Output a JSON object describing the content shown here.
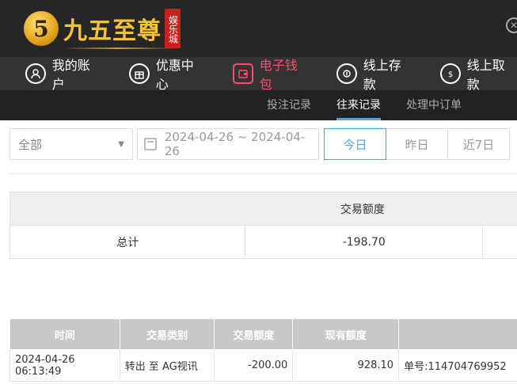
{
  "brand": {
    "badge": "5",
    "name": "九五至尊",
    "seal": "娱乐城"
  },
  "nav": {
    "items": [
      {
        "label": "我的账户",
        "icon": "user-icon"
      },
      {
        "label": "优惠中心",
        "icon": "gift-icon"
      },
      {
        "label": "电子钱包",
        "icon": "wallet-icon",
        "active": true
      },
      {
        "label": "线上存款",
        "icon": "deposit-icon"
      },
      {
        "label": "线上取款",
        "icon": "withdraw-icon"
      }
    ]
  },
  "subnav": {
    "items": [
      {
        "label": "投注记录"
      },
      {
        "label": "往来记录",
        "active": true
      },
      {
        "label": "处理中订单"
      }
    ]
  },
  "filters": {
    "type_select": "全部",
    "date_range": "2024-04-26 ~ 2024-04-26",
    "quick_ranges": [
      "今日",
      "昨日",
      "近7日"
    ],
    "active_range": "今日"
  },
  "summary": {
    "column_header": "交易额度",
    "row_label": "总计",
    "total": "-198.70"
  },
  "records": {
    "columns": [
      "时间",
      "交易类别",
      "交易额度",
      "现有额度",
      ""
    ],
    "rows": [
      {
        "time": "2024-04-26 06:13:49",
        "type": "转出 至 AG视讯",
        "amount": "-200.00",
        "balance": "928.10",
        "note": "单号:114704769952"
      }
    ]
  },
  "colors": {
    "header_bg": "#262626",
    "nav_bg": "#333333",
    "active_nav": "#ff4d6d",
    "accent_blue": "#4fa3e0"
  }
}
